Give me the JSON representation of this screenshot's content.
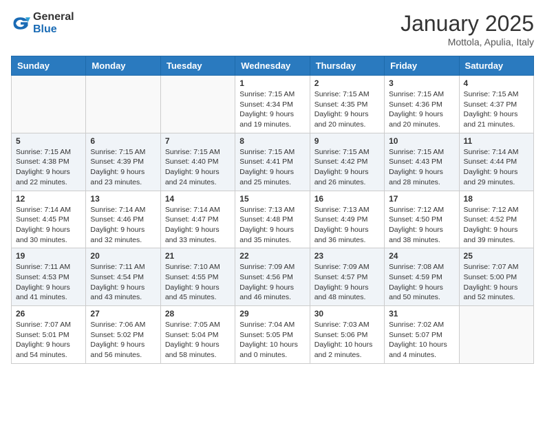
{
  "header": {
    "logo_general": "General",
    "logo_blue": "Blue",
    "month_year": "January 2025",
    "location": "Mottola, Apulia, Italy"
  },
  "days_of_week": [
    "Sunday",
    "Monday",
    "Tuesday",
    "Wednesday",
    "Thursday",
    "Friday",
    "Saturday"
  ],
  "weeks": [
    [
      {
        "day": "",
        "info": ""
      },
      {
        "day": "",
        "info": ""
      },
      {
        "day": "",
        "info": ""
      },
      {
        "day": "1",
        "info": "Sunrise: 7:15 AM\nSunset: 4:34 PM\nDaylight: 9 hours\nand 19 minutes."
      },
      {
        "day": "2",
        "info": "Sunrise: 7:15 AM\nSunset: 4:35 PM\nDaylight: 9 hours\nand 20 minutes."
      },
      {
        "day": "3",
        "info": "Sunrise: 7:15 AM\nSunset: 4:36 PM\nDaylight: 9 hours\nand 20 minutes."
      },
      {
        "day": "4",
        "info": "Sunrise: 7:15 AM\nSunset: 4:37 PM\nDaylight: 9 hours\nand 21 minutes."
      }
    ],
    [
      {
        "day": "5",
        "info": "Sunrise: 7:15 AM\nSunset: 4:38 PM\nDaylight: 9 hours\nand 22 minutes."
      },
      {
        "day": "6",
        "info": "Sunrise: 7:15 AM\nSunset: 4:39 PM\nDaylight: 9 hours\nand 23 minutes."
      },
      {
        "day": "7",
        "info": "Sunrise: 7:15 AM\nSunset: 4:40 PM\nDaylight: 9 hours\nand 24 minutes."
      },
      {
        "day": "8",
        "info": "Sunrise: 7:15 AM\nSunset: 4:41 PM\nDaylight: 9 hours\nand 25 minutes."
      },
      {
        "day": "9",
        "info": "Sunrise: 7:15 AM\nSunset: 4:42 PM\nDaylight: 9 hours\nand 26 minutes."
      },
      {
        "day": "10",
        "info": "Sunrise: 7:15 AM\nSunset: 4:43 PM\nDaylight: 9 hours\nand 28 minutes."
      },
      {
        "day": "11",
        "info": "Sunrise: 7:14 AM\nSunset: 4:44 PM\nDaylight: 9 hours\nand 29 minutes."
      }
    ],
    [
      {
        "day": "12",
        "info": "Sunrise: 7:14 AM\nSunset: 4:45 PM\nDaylight: 9 hours\nand 30 minutes."
      },
      {
        "day": "13",
        "info": "Sunrise: 7:14 AM\nSunset: 4:46 PM\nDaylight: 9 hours\nand 32 minutes."
      },
      {
        "day": "14",
        "info": "Sunrise: 7:14 AM\nSunset: 4:47 PM\nDaylight: 9 hours\nand 33 minutes."
      },
      {
        "day": "15",
        "info": "Sunrise: 7:13 AM\nSunset: 4:48 PM\nDaylight: 9 hours\nand 35 minutes."
      },
      {
        "day": "16",
        "info": "Sunrise: 7:13 AM\nSunset: 4:49 PM\nDaylight: 9 hours\nand 36 minutes."
      },
      {
        "day": "17",
        "info": "Sunrise: 7:12 AM\nSunset: 4:50 PM\nDaylight: 9 hours\nand 38 minutes."
      },
      {
        "day": "18",
        "info": "Sunrise: 7:12 AM\nSunset: 4:52 PM\nDaylight: 9 hours\nand 39 minutes."
      }
    ],
    [
      {
        "day": "19",
        "info": "Sunrise: 7:11 AM\nSunset: 4:53 PM\nDaylight: 9 hours\nand 41 minutes."
      },
      {
        "day": "20",
        "info": "Sunrise: 7:11 AM\nSunset: 4:54 PM\nDaylight: 9 hours\nand 43 minutes."
      },
      {
        "day": "21",
        "info": "Sunrise: 7:10 AM\nSunset: 4:55 PM\nDaylight: 9 hours\nand 45 minutes."
      },
      {
        "day": "22",
        "info": "Sunrise: 7:09 AM\nSunset: 4:56 PM\nDaylight: 9 hours\nand 46 minutes."
      },
      {
        "day": "23",
        "info": "Sunrise: 7:09 AM\nSunset: 4:57 PM\nDaylight: 9 hours\nand 48 minutes."
      },
      {
        "day": "24",
        "info": "Sunrise: 7:08 AM\nSunset: 4:59 PM\nDaylight: 9 hours\nand 50 minutes."
      },
      {
        "day": "25",
        "info": "Sunrise: 7:07 AM\nSunset: 5:00 PM\nDaylight: 9 hours\nand 52 minutes."
      }
    ],
    [
      {
        "day": "26",
        "info": "Sunrise: 7:07 AM\nSunset: 5:01 PM\nDaylight: 9 hours\nand 54 minutes."
      },
      {
        "day": "27",
        "info": "Sunrise: 7:06 AM\nSunset: 5:02 PM\nDaylight: 9 hours\nand 56 minutes."
      },
      {
        "day": "28",
        "info": "Sunrise: 7:05 AM\nSunset: 5:04 PM\nDaylight: 9 hours\nand 58 minutes."
      },
      {
        "day": "29",
        "info": "Sunrise: 7:04 AM\nSunset: 5:05 PM\nDaylight: 10 hours\nand 0 minutes."
      },
      {
        "day": "30",
        "info": "Sunrise: 7:03 AM\nSunset: 5:06 PM\nDaylight: 10 hours\nand 2 minutes."
      },
      {
        "day": "31",
        "info": "Sunrise: 7:02 AM\nSunset: 5:07 PM\nDaylight: 10 hours\nand 4 minutes."
      },
      {
        "day": "",
        "info": ""
      }
    ]
  ]
}
